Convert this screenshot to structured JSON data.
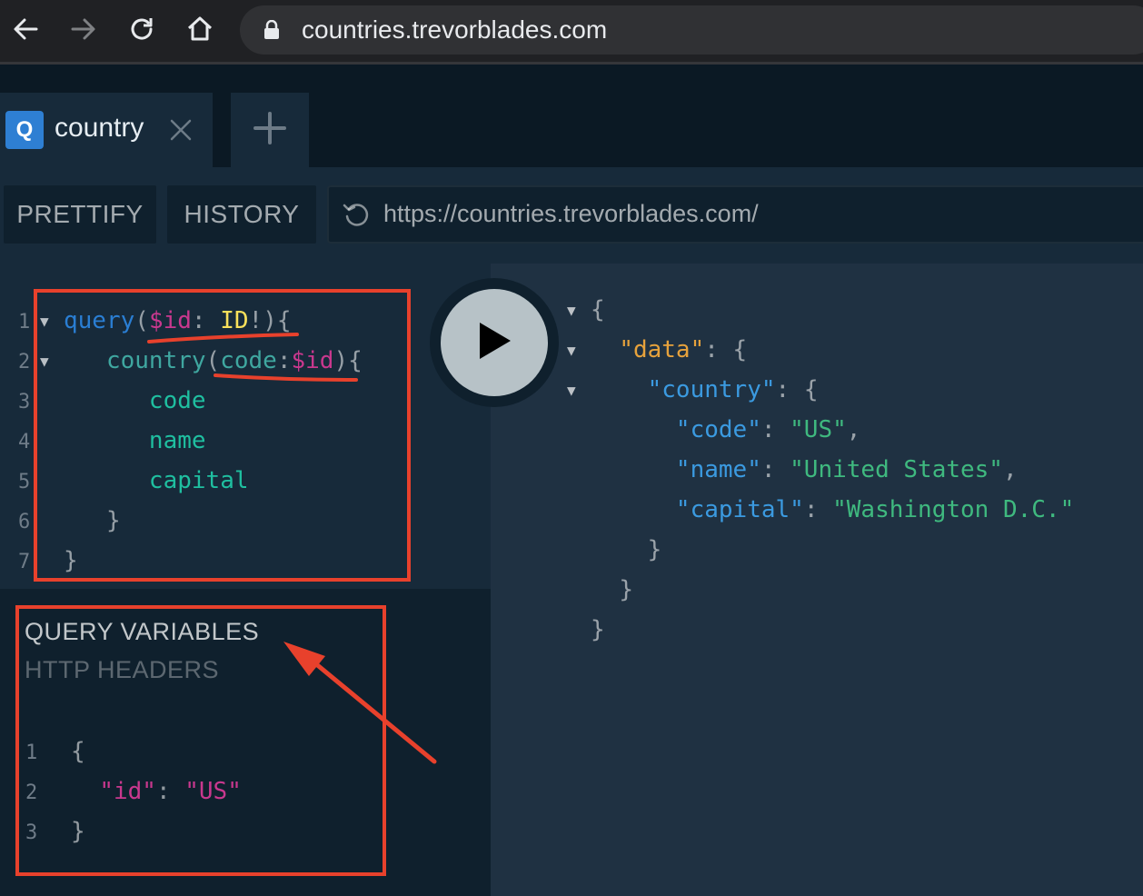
{
  "browser": {
    "url": "countries.trevorblades.com",
    "icons": [
      "back-arrow-icon",
      "forward-arrow-icon",
      "reload-icon",
      "home-icon",
      "lock-icon"
    ]
  },
  "tabs": [
    {
      "badge": "Q",
      "label": "country",
      "close_icon": "close-icon"
    }
  ],
  "new_tab_icon": "plus-icon",
  "toolbar": {
    "prettify_label": "PRETTIFY",
    "history_label": "HISTORY",
    "endpoint_url": "https://countries.trevorblades.com/",
    "reload_icon": "history-reload-icon"
  },
  "editor": {
    "line_numbers": [
      "1",
      "2",
      "3",
      "4",
      "5",
      "6",
      "7"
    ],
    "line1": {
      "keyword": "query",
      "open": "(",
      "var": "$id",
      "colon": ": ",
      "type": "ID",
      "bang": "!",
      "close": ")",
      "brace": "{"
    },
    "line2": {
      "field": "country",
      "open": "(",
      "arg": "code",
      "colon": ":",
      "var": "$id",
      "close": ")",
      "brace": "{"
    },
    "fields": [
      "code",
      "name",
      "capital"
    ],
    "close_inner": "}",
    "close_outer": "}"
  },
  "variables_panel": {
    "tab_active": "QUERY VARIABLES",
    "tab_inactive": "HTTP HEADERS",
    "line_numbers": [
      "1",
      "2",
      "3"
    ],
    "open": "{",
    "key": "\"id\"",
    "colon": ": ",
    "value": "\"US\"",
    "close": "}"
  },
  "run_button": {
    "icon": "play-icon"
  },
  "result": {
    "open": "{",
    "data_key": "\"data\"",
    "country_key": "\"country\"",
    "colon": ": ",
    "brace_open": "{",
    "code_key": "\"code\"",
    "code_value": "\"US\"",
    "name_key": "\"name\"",
    "name_value": "\"United States\"",
    "capital_key": "\"capital\"",
    "capital_value": "\"Washington D.C.\"",
    "comma": ",",
    "close": "}"
  },
  "colors": {
    "annotation": "#e8412c",
    "keyword": "#2a7ed3",
    "variable": "#c9388e",
    "type": "#f8e05b",
    "field": "#1fbfa0",
    "json_key": "#3b9ae0",
    "json_string": "#3fb97f",
    "data_key": "#e6a23c"
  }
}
